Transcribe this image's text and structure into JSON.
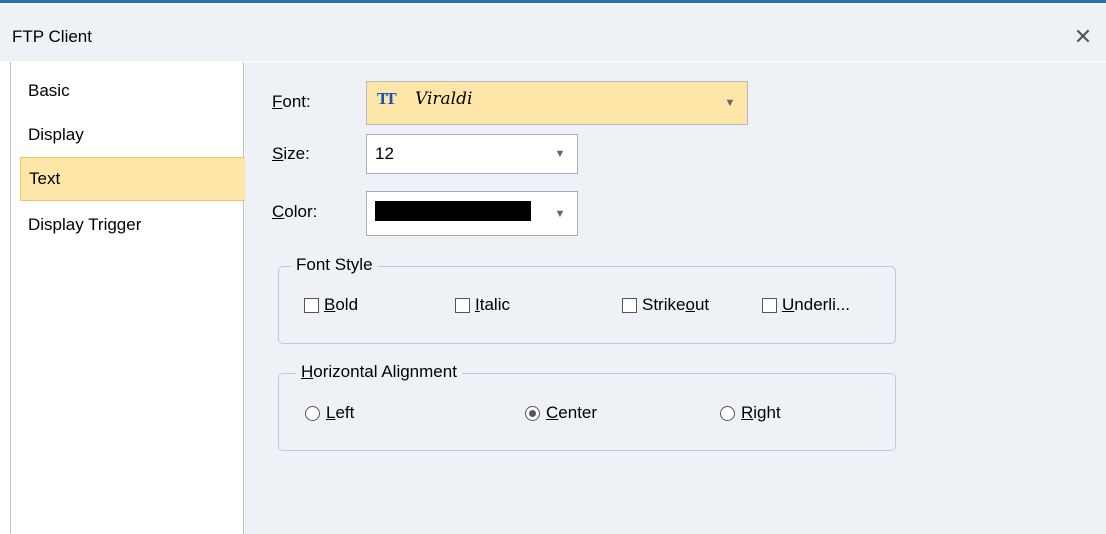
{
  "window": {
    "title": "FTP Client",
    "close_glyph": "✕"
  },
  "sidebar": {
    "items": [
      {
        "label": "Basic",
        "selected": false
      },
      {
        "label": "Display",
        "selected": false
      },
      {
        "label": "Text",
        "selected": true
      },
      {
        "label": "Display Trigger",
        "selected": false
      }
    ]
  },
  "font": {
    "label_u": "F",
    "label_rest": "ont:",
    "value": "Viraldi",
    "icon": "TT"
  },
  "size": {
    "label_u": "S",
    "label_rest": "ize:",
    "value": "12"
  },
  "color": {
    "label_u": "C",
    "label_rest": "olor:",
    "value_color": "#000000"
  },
  "font_style": {
    "title": "Font Style",
    "options": [
      {
        "u": "B",
        "rest": "old",
        "checked": false
      },
      {
        "u": "I",
        "rest": "talic",
        "checked": false
      },
      {
        "pre": "Strike",
        "u": "o",
        "rest": "ut",
        "checked": false
      },
      {
        "u": "U",
        "rest": "nderli...",
        "checked": false
      }
    ]
  },
  "h_align": {
    "title_u": "H",
    "title_rest": "orizontal Alignment",
    "options": [
      {
        "u": "L",
        "rest": "eft",
        "selected": false
      },
      {
        "u": "C",
        "rest": "enter",
        "selected": true
      },
      {
        "u": "R",
        "rest": "ight",
        "selected": false
      }
    ]
  },
  "colors": {
    "selection_bg": "#fde6a8",
    "panel_bg": "#eef1f6",
    "accent": "#2b6cb0"
  }
}
